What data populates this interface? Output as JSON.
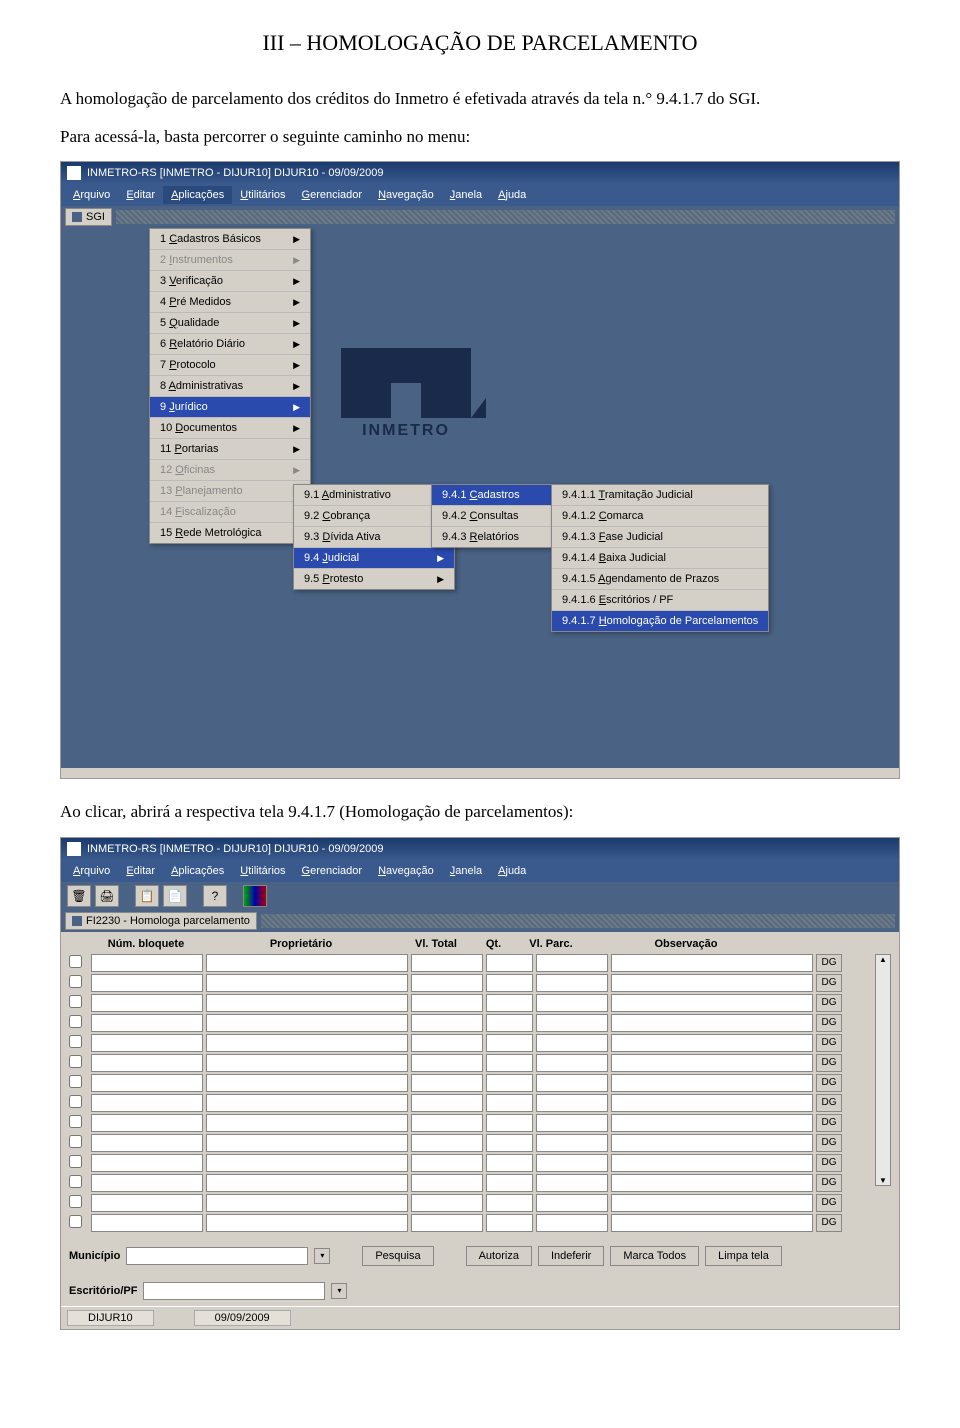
{
  "doc": {
    "title": "III – HOMOLOGAÇÃO DE PARCELAMENTO",
    "para1": "A homologação de parcelamento dos créditos do Inmetro é efetivada através da tela n.° 9.4.1.7 do SGI.",
    "para2": "Para acessá-la, basta percorrer o seguinte caminho no menu:",
    "para3": "Ao clicar, abrirá a respectiva tela 9.4.1.7 (Homologação de parcelamentos):"
  },
  "shot1": {
    "title": "INMETRO-RS  [INMETRO - DIJUR10]    DIJUR10 - 09/09/2009",
    "menus": [
      "Arquivo",
      "Editar",
      "Aplicações",
      "Utilitários",
      "Gerenciador",
      "Navegação",
      "Janela",
      "Ajuda"
    ],
    "active_menu_index": 2,
    "sgi_label": "SGI",
    "dropdown1": [
      {
        "t": "1 Cadastros Básicos",
        "a": true
      },
      {
        "t": "2 Instrumentos",
        "a": true,
        "dis": true
      },
      {
        "t": "3 Verificação",
        "a": true
      },
      {
        "t": "4 Pré Medidos",
        "a": true
      },
      {
        "t": "5 Qualidade",
        "a": true
      },
      {
        "t": "6 Relatório Diário",
        "a": true
      },
      {
        "t": "7 Protocolo",
        "a": true
      },
      {
        "t": "8 Administrativas",
        "a": true
      },
      {
        "t": "9 Jurídico",
        "a": true,
        "sel": true
      },
      {
        "t": "10 Documentos",
        "a": true
      },
      {
        "t": "11 Portarias",
        "a": true
      },
      {
        "t": "12 Oficinas",
        "a": true,
        "dis": true
      },
      {
        "t": "13 Planejamento",
        "a": true,
        "dis": true
      },
      {
        "t": "14 Fiscalização",
        "a": true,
        "dis": true
      },
      {
        "t": "15 Rede Metrológica",
        "a": true
      }
    ],
    "dropdown2": [
      {
        "t": "9.1 Administrativo",
        "a": true
      },
      {
        "t": "9.2 Cobrança",
        "a": true
      },
      {
        "t": "9.3 Dívida Ativa",
        "a": true
      },
      {
        "t": "9.4 Judicial",
        "a": true,
        "sel": true
      },
      {
        "t": "9.5 Protesto",
        "a": true
      }
    ],
    "dropdown3": [
      {
        "t": "9.4.1 Cadastros",
        "a": true,
        "sel": true
      },
      {
        "t": "9.4.2 Consultas",
        "a": true
      },
      {
        "t": "9.4.3 Relatórios",
        "a": true
      }
    ],
    "dropdown4": [
      {
        "t": "9.4.1.1 Tramitação Judicial"
      },
      {
        "t": "9.4.1.2 Comarca"
      },
      {
        "t": "9.4.1.3 Fase Judicial"
      },
      {
        "t": "9.4.1.4 Baixa Judicial"
      },
      {
        "t": "9.4.1.5 Agendamento de Prazos"
      },
      {
        "t": "9.4.1.6 Escritórios / PF"
      },
      {
        "t": "9.4.1.7 Homologação de Parcelamentos",
        "sel": true
      }
    ],
    "logo_text": "INMETRO"
  },
  "shot2": {
    "title": "INMETRO-RS  [INMETRO - DIJUR10]    DIJUR10 - 09/09/2009",
    "menus": [
      "Arquivo",
      "Editar",
      "Aplicações",
      "Utilitários",
      "Gerenciador",
      "Navegação",
      "Janela",
      "Ajuda"
    ],
    "form_title": "FI2230 - Homologa parcelamento",
    "headers": {
      "num": "Núm. bloquete",
      "prop": "Proprietário",
      "tot": "Vl. Total",
      "qt": "Qt.",
      "parc": "Vl. Parc.",
      "obs": "Observação"
    },
    "dg_label": "DG",
    "row_count": 14,
    "bottom": {
      "municipio_label": "Município",
      "escritorio_label": "Escritório/PF",
      "btn_pesquisa": "Pesquisa",
      "btn_autoriza": "Autoriza",
      "btn_indeferir": "Indeferir",
      "btn_marca": "Marca Todos",
      "btn_limpa": "Limpa tela"
    },
    "status_user": "DIJUR10",
    "status_date": "09/09/2009"
  }
}
